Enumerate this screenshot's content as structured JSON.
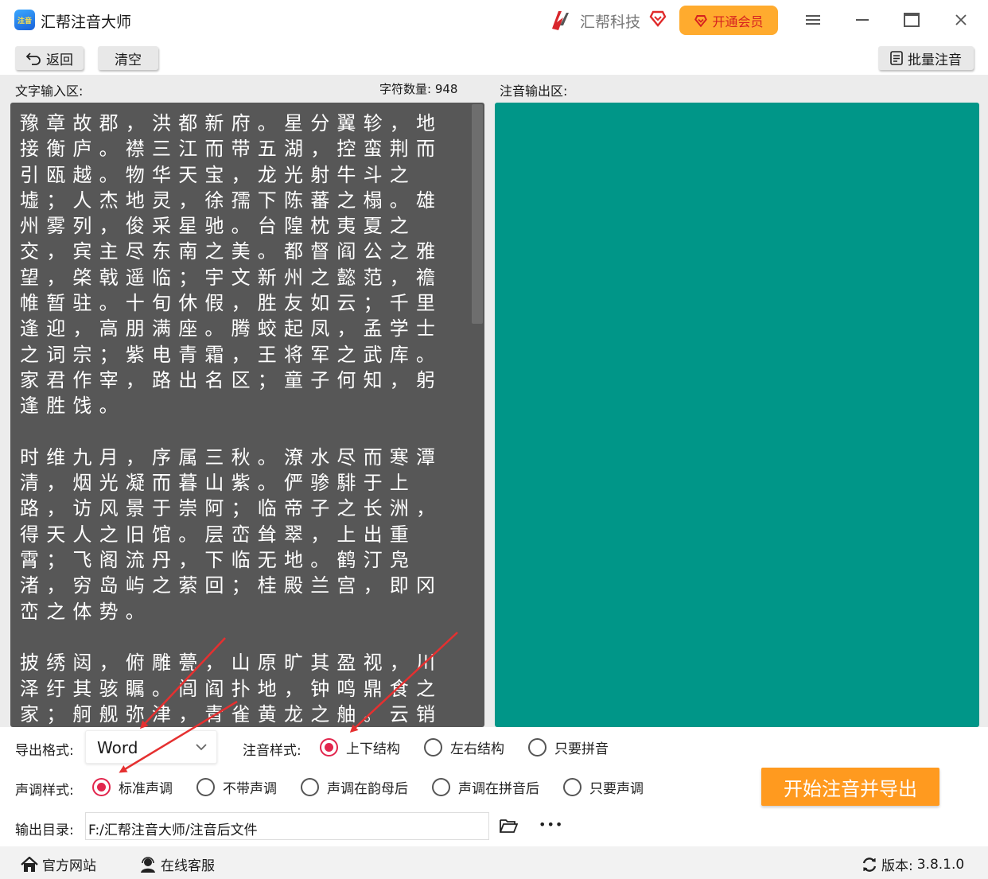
{
  "titlebar": {
    "logo_text": "注音",
    "app_title": "汇帮注音大师",
    "brand_name": "汇帮科技",
    "vip_label": "开通会员"
  },
  "toolbar": {
    "back_label": "返回",
    "clear_label": "清空",
    "batch_label": "批量注音"
  },
  "input": {
    "section_label": "文字输入区:",
    "char_count_label": "字符数量:",
    "char_count": "948",
    "text": "豫章故郡，洪都新府。星分翼轸，地接衡庐。襟三江而带五湖，控蛮荆而引瓯越。物华天宝，龙光射牛斗之墟；人杰地灵，徐孺下陈蕃之榻。雄州雾列，俊采星驰。台隍枕夷夏之交，宾主尽东南之美。都督阎公之雅望，棨戟遥临；宇文新州之懿范，襜帷暂驻。十旬休假，胜友如云；千里逢迎，高朋满座。腾蛟起凤，孟学士之词宗；紫电青霜，王将军之武库。家君作宰，路出名区；童子何知，躬逢胜饯。\n\n时维九月，序属三秋。潦水尽而寒潭清，烟光凝而暮山紫。俨骖騑于上路，访风景于崇阿；临帝子之长洲，得天人之旧馆。层峦耸翠，上出重霄；飞阁流丹，下临无地。鹤汀凫渚，穷岛屿之萦回；桂殿兰宫，即冈峦之体势。\n\n披绣闼，俯雕甍，山原旷其盈视，川泽纡其骇瞩。闾阎扑地，钟鸣鼎食之家；舸舰弥津，青雀黄龙之舳。云销雨霁，彩彻区明。落霞与孤鹜齐飞，秋水共长天一色。渔舟唱晚，响穷彭蠡之滨；雁阵"
  },
  "output": {
    "section_label": "注音输出区:"
  },
  "settings": {
    "export_format_label": "导出格式:",
    "export_format_value": "Word",
    "pinyin_style_label": "注音样式:",
    "pinyin_styles": [
      "上下结构",
      "左右结构",
      "只要拼音"
    ],
    "pinyin_style_selected": "上下结构",
    "tone_style_label": "声调样式:",
    "tone_styles": [
      "标准声调",
      "不带声调",
      "声调在韵母后",
      "声调在拼音后",
      "只要声调"
    ],
    "tone_style_selected": "标准声调",
    "output_dir_label": "输出目录:",
    "output_dir_value": "F:/汇帮注音大师/注音后文件",
    "more_label": "•••",
    "start_button": "开始注音并导出"
  },
  "statusbar": {
    "website_label": "官方网站",
    "support_label": "在线客服",
    "version_label": "版本:",
    "version_value": "3.8.1.0"
  },
  "colors": {
    "accent_orange": "#ff9a1f",
    "vip_bg": "#ffab2e",
    "output_teal": "#009688",
    "input_gray": "#575757",
    "radio_red": "#e2264d",
    "arrow_red": "#e53030"
  },
  "icons": {
    "back": "undo-arrow-icon",
    "batch": "document-list-icon",
    "folder": "folder-open-icon",
    "home": "home-icon",
    "support": "headset-user-icon",
    "refresh": "refresh-icon"
  }
}
